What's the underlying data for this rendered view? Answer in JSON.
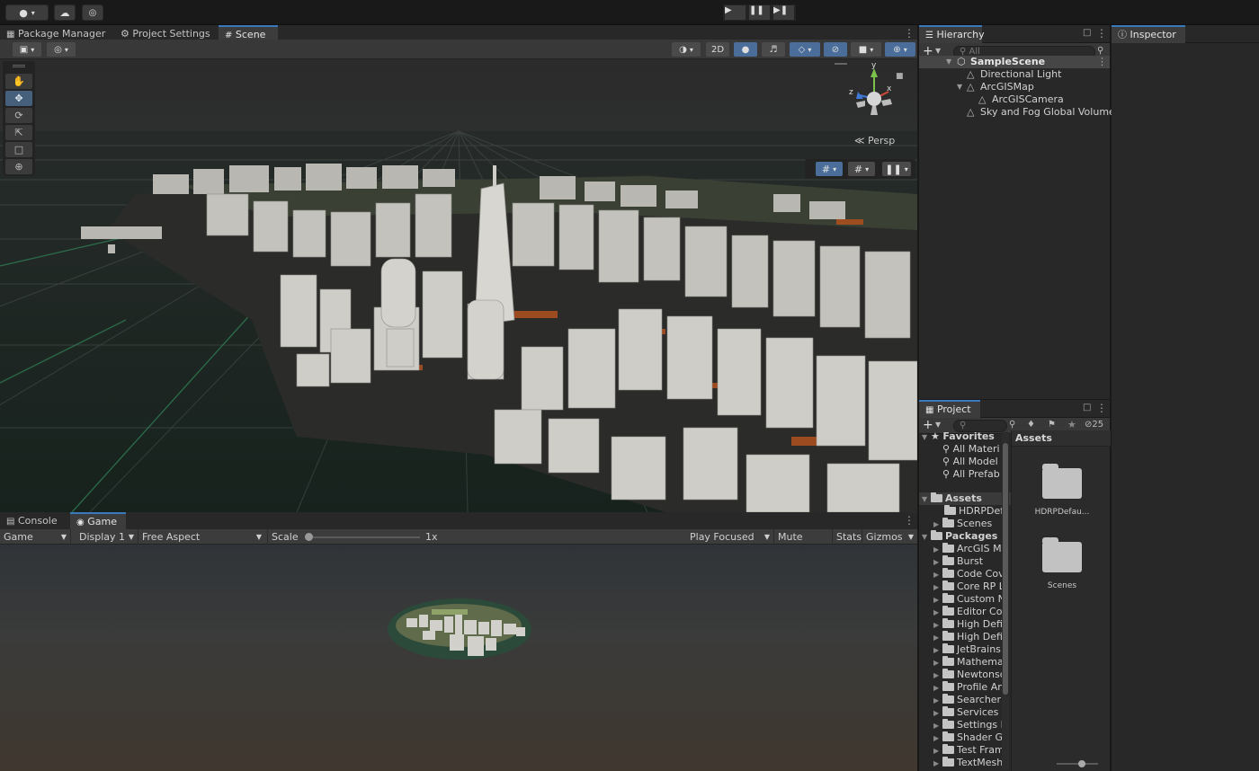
{
  "topbar": {
    "account_icon": "account-circle-icon",
    "cloud_icon": "cloud-icon",
    "collab_icon": "collab-icon",
    "play_icon": "play-icon",
    "pause_icon": "pause-icon",
    "step_icon": "step-icon"
  },
  "scene_tabs": {
    "package_manager": "Package Manager",
    "project_settings": "Project Settings",
    "scene": "Scene"
  },
  "scene_toolbar": {
    "mode_2d": "2D"
  },
  "scene_view": {
    "gizmo_axes": {
      "x": "x",
      "y": "y",
      "z": "z"
    },
    "projection_label": "Persp"
  },
  "game_tabs": {
    "console": "Console",
    "game": "Game"
  },
  "game_toolbar": {
    "view_mode": "Game",
    "display": "Display 1",
    "aspect": "Free Aspect",
    "scale_label": "Scale",
    "scale_value": "1x",
    "scale_fraction": 0.0,
    "play_focused": "Play Focused",
    "mute_audio": "Mute Audio",
    "stats": "Stats",
    "gizmos": "Gizmos"
  },
  "hierarchy": {
    "tab": "Hierarchy",
    "search_placeholder": "All",
    "scene_name": "SampleScene",
    "items": [
      {
        "label": "Directional Light"
      },
      {
        "label": "ArcGISMap"
      },
      {
        "label": "ArcGISCamera"
      },
      {
        "label": "Sky and Fog Global Volume"
      }
    ]
  },
  "project": {
    "tab": "Project",
    "badge_count": "25",
    "favorites_label": "Favorites",
    "favorites": [
      "All Materi",
      "All Model",
      "All Prefab"
    ],
    "assets_label": "Assets",
    "assets": [
      "HDRPDef",
      "Scenes"
    ],
    "packages_label": "Packages",
    "packages": [
      "ArcGIS M",
      "Burst",
      "Code Cov",
      "Core RP L",
      "Custom N",
      "Editor Co",
      "High Defi",
      "High Defi",
      "JetBrains",
      "Mathema",
      "Newtonsc",
      "Profile An",
      "Searcher",
      "Services",
      "Settings M",
      "Shader G",
      "Test Fram",
      "TextMesh"
    ],
    "grid_header": "Assets",
    "grid_items": [
      "HDRPDefau...",
      "Scenes"
    ]
  },
  "inspector": {
    "tab": "Inspector"
  },
  "colors": {
    "accent": "#3a79bb",
    "panel": "#282828",
    "toolbar": "#383838",
    "building": "#c8c6c1",
    "ground": "#1d2a24"
  }
}
